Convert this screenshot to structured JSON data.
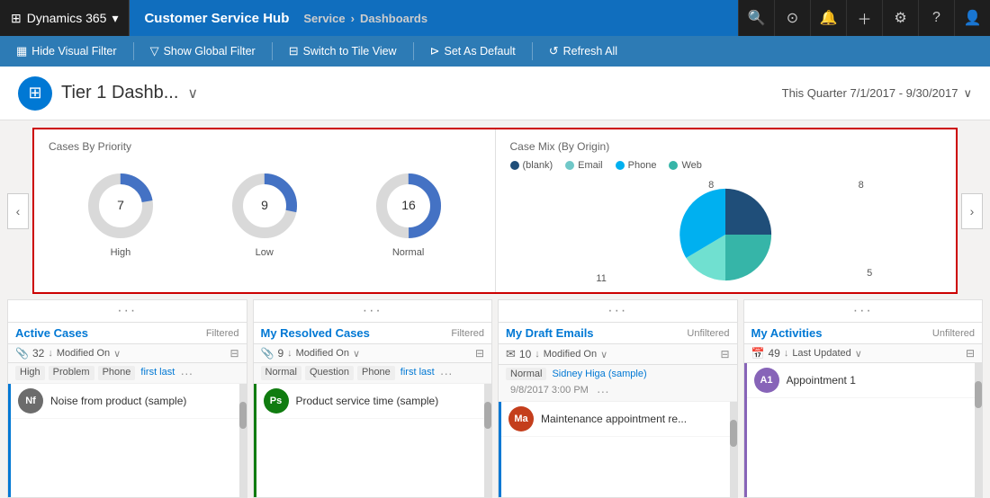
{
  "topnav": {
    "dynamics_label": "Dynamics 365",
    "app_name": "Customer Service Hub",
    "breadcrumb": {
      "part1": "Service",
      "sep": "›",
      "part2": "Dashboards"
    },
    "icons": [
      "🔍",
      "🎯",
      "🔔",
      "+",
      "⚙",
      "?",
      "👤"
    ]
  },
  "toolbar": {
    "hide_visual_filter": "Hide Visual Filter",
    "show_global_filter": "Show Global Filter",
    "switch_to_tile_view": "Switch to Tile View",
    "set_as_default": "Set As Default",
    "refresh_all": "Refresh All"
  },
  "dashboard": {
    "title": "Tier 1 Dashb...",
    "date_range": "This Quarter 7/1/2017 - 9/30/2017"
  },
  "charts": {
    "cases_by_priority": {
      "title": "Cases By Priority",
      "items": [
        {
          "label": "High",
          "value": 7,
          "blue_pct": 22,
          "gray_pct": 78
        },
        {
          "label": "Low",
          "value": 9,
          "blue_pct": 28,
          "gray_pct": 72
        },
        {
          "label": "Normal",
          "value": 16,
          "blue_pct": 50,
          "gray_pct": 50
        }
      ]
    },
    "case_mix": {
      "title": "Case Mix (By Origin)",
      "legend": [
        {
          "label": "(blank)",
          "color": "#1f4e79"
        },
        {
          "label": "Email",
          "color": "#70c8c8"
        },
        {
          "label": "Phone",
          "color": "#00b0f0"
        },
        {
          "label": "Web",
          "color": "#36b5a8"
        }
      ],
      "segments": [
        {
          "label": "8",
          "value": 8,
          "color": "#1f4e79",
          "startAngle": 0,
          "endAngle": 100
        },
        {
          "label": "8",
          "value": 8,
          "color": "#36b5a8",
          "startAngle": 100,
          "endAngle": 200
        },
        {
          "label": "5",
          "value": 5,
          "color": "#70e0d0",
          "startAngle": 200,
          "endAngle": 263
        },
        {
          "label": "11",
          "value": 11,
          "color": "#00b0f0",
          "startAngle": 263,
          "endAngle": 360
        }
      ]
    }
  },
  "cards": [
    {
      "title": "Active Cases",
      "filter_status": "Filtered",
      "count": "32",
      "sort_field": "Modified On",
      "left_bar_color": "#0078d4",
      "tags": [
        "High",
        "Problem",
        "Phone",
        "first last",
        "···"
      ],
      "items": [
        {
          "initials": "Nf",
          "bg": "#6c6c6c",
          "text": "Noise from product (sample)"
        }
      ]
    },
    {
      "title": "My Resolved Cases",
      "filter_status": "Filtered",
      "count": "9",
      "sort_field": "Modified On",
      "left_bar_color": "#107c10",
      "tags": [
        "Normal",
        "Question",
        "Phone",
        "first last",
        "···"
      ],
      "items": [
        {
          "initials": "Ps",
          "bg": "#107c10",
          "text": "Product service time (sample)"
        }
      ]
    },
    {
      "title": "My Draft Emails",
      "filter_status": "Unfiltered",
      "count": "10",
      "sort_field": "Modified On",
      "left_bar_color": "#0078d4",
      "tags": [
        "Normal",
        "Sidney Higa (sample)",
        "9/8/2017 3:00 PM",
        "···"
      ],
      "items": [
        {
          "initials": "Ma",
          "bg": "#c43e1c",
          "text": "Maintenance appointment re..."
        }
      ]
    },
    {
      "title": "My Activities",
      "filter_status": "Unfiltered",
      "count": "49",
      "sort_field": "Last Updated",
      "left_bar_color": "#8764b8",
      "tags": [],
      "items": [
        {
          "initials": "A1",
          "bg": "#8764b8",
          "text": "Appointment 1",
          "is_appointment": true
        }
      ]
    }
  ]
}
